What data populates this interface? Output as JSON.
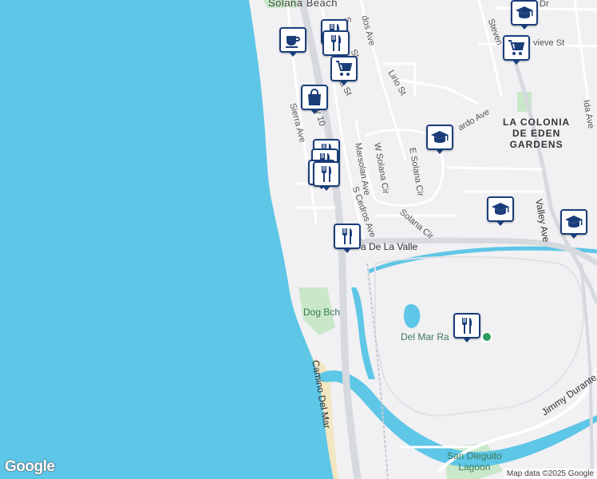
{
  "map": {
    "colors": {
      "water": "#5ec6e6",
      "land": "#f1f0f3",
      "park": "#c9e8c9",
      "sand": "#f3e6c2",
      "road_major": "#d6d9de",
      "road_minor": "#ffffff",
      "pin_border": "#1a3d7a"
    },
    "labels": {
      "solana_beach": "Solana Beach",
      "la_colonia": "LA COLONIA\nDE EDEN\nGARDENS",
      "dog_beach": "Dog Bch",
      "del_mar_racetrack": "Del Mar Ra",
      "camino_del_mar": "Camino Del Mar",
      "via_de_la_valle": "a De La Valle",
      "jimmy_durante": "Jimmy Durante Blvd",
      "san_dieguito_lagoon": "San Dieguito\nLagoon",
      "valley_ave": "Valley Ave",
      "s_cedros": "S Cedros Ave",
      "marsolan": "Marsolan Ave",
      "w_solana_cir": "W Solana Cir",
      "e_solana_cir": "E Solana Cir",
      "solana_cir": "Solana Cir",
      "lirio_st": "Lirio St",
      "sierra_ave": "Sierra Ave",
      "hwy_101": "y 10",
      "stevens": "Steven",
      "genevieve": "vieve St",
      "ida_ave": "Ida Ave",
      "adr": "Dr",
      "olvido": "ardo Ave",
      "lomas": "dos Ave",
      "s_sierra": "S",
      "st": "St",
      "na_st": "na St"
    },
    "pins": [
      {
        "type": "coffee"
      },
      {
        "type": "restaurant"
      },
      {
        "type": "restaurant"
      },
      {
        "type": "shopping-cart"
      },
      {
        "type": "shopping-bag"
      },
      {
        "type": "restaurant"
      },
      {
        "type": "restaurant"
      },
      {
        "type": "restaurant"
      },
      {
        "type": "restaurant"
      },
      {
        "type": "school"
      },
      {
        "type": "school"
      },
      {
        "type": "school"
      },
      {
        "type": "school"
      },
      {
        "type": "shopping-cart"
      },
      {
        "type": "restaurant"
      },
      {
        "type": "restaurant"
      }
    ],
    "google_logo": "Google",
    "attribution": "Map data ©2025 Google"
  }
}
